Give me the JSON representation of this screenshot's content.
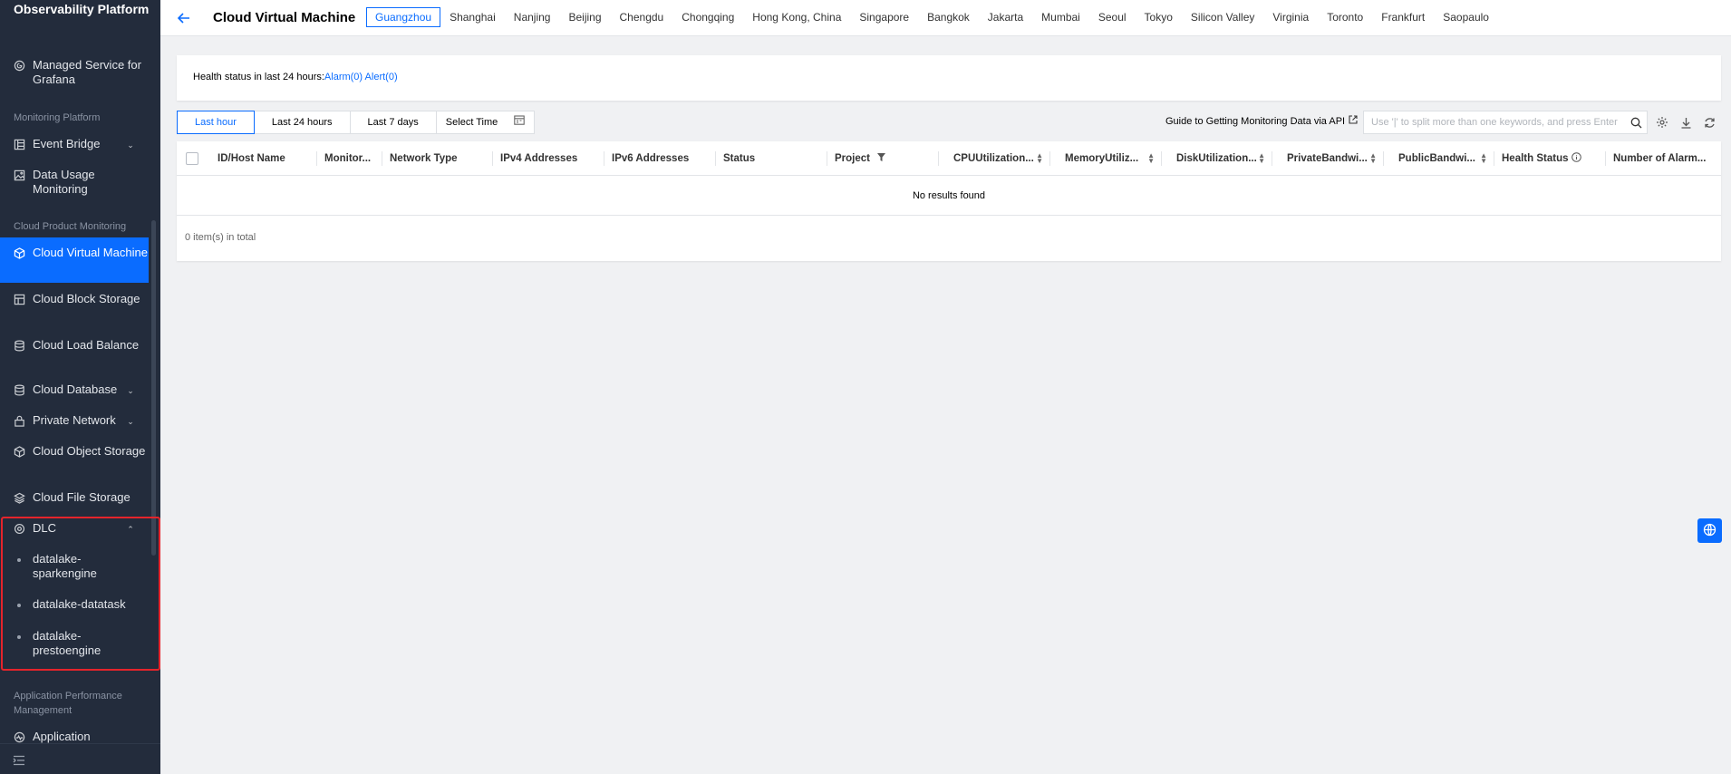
{
  "sidebar": {
    "title": "Observability Platform",
    "grafana": "Managed Service for Grafana",
    "section_monitoring": "Monitoring Platform",
    "event_bridge": "Event Bridge",
    "data_usage": "Data Usage Monitoring",
    "section_cloud_product": "Cloud Product Monitoring",
    "cvm": "Cloud Virtual Machine",
    "cbs": "Cloud Block Storage",
    "clb": "Cloud Load Balance",
    "cdb": "Cloud Database",
    "private_network": "Private Network",
    "cos": "Cloud Object Storage",
    "cfs": "Cloud File Storage",
    "dlc": "DLC",
    "dlc_sub": [
      "datalake-sparkengine",
      "datalake-datatask",
      "datalake-prestoengine"
    ],
    "section_apm": "Application Performance Management",
    "application": "Application"
  },
  "header": {
    "title": "Cloud Virtual Machine",
    "regions": [
      "Guangzhou",
      "Shanghai",
      "Nanjing",
      "Beijing",
      "Chengdu",
      "Chongqing",
      "Hong Kong, China",
      "Singapore",
      "Bangkok",
      "Jakarta",
      "Mumbai",
      "Seoul",
      "Tokyo",
      "Silicon Valley",
      "Virginia",
      "Toronto",
      "Frankfurt",
      "Saopaulo"
    ],
    "selected_region": "Guangzhou"
  },
  "health": {
    "prefix": "Health status in last 24 hours:",
    "alarm": "Alarm(0)",
    "alert": "Alert(0)"
  },
  "toolbar": {
    "time_tabs": [
      "Last hour",
      "Last 24 hours",
      "Last 7 days"
    ],
    "select_time": "Select Time",
    "guide": "Guide to Getting Monitoring Data via API",
    "search_placeholder": "Use '|' to split more than one keywords, and press Enter to"
  },
  "table": {
    "columns": [
      "ID/Host Name",
      "Monitor...",
      "Network Type",
      "IPv4 Addresses",
      "IPv6 Addresses",
      "Status",
      "Project",
      "CPUUtilization...",
      "MemoryUtiliz...",
      "DiskUtilization...",
      "PrivateBandwi...",
      "PublicBandwi...",
      "Health Status",
      "Number of Alarm..."
    ],
    "empty": "No results found",
    "total": "0 item(s) in total"
  },
  "colors": {
    "accent": "#0a6cff",
    "sidebar_bg": "#232c3c",
    "highlight": "#e5242b"
  }
}
